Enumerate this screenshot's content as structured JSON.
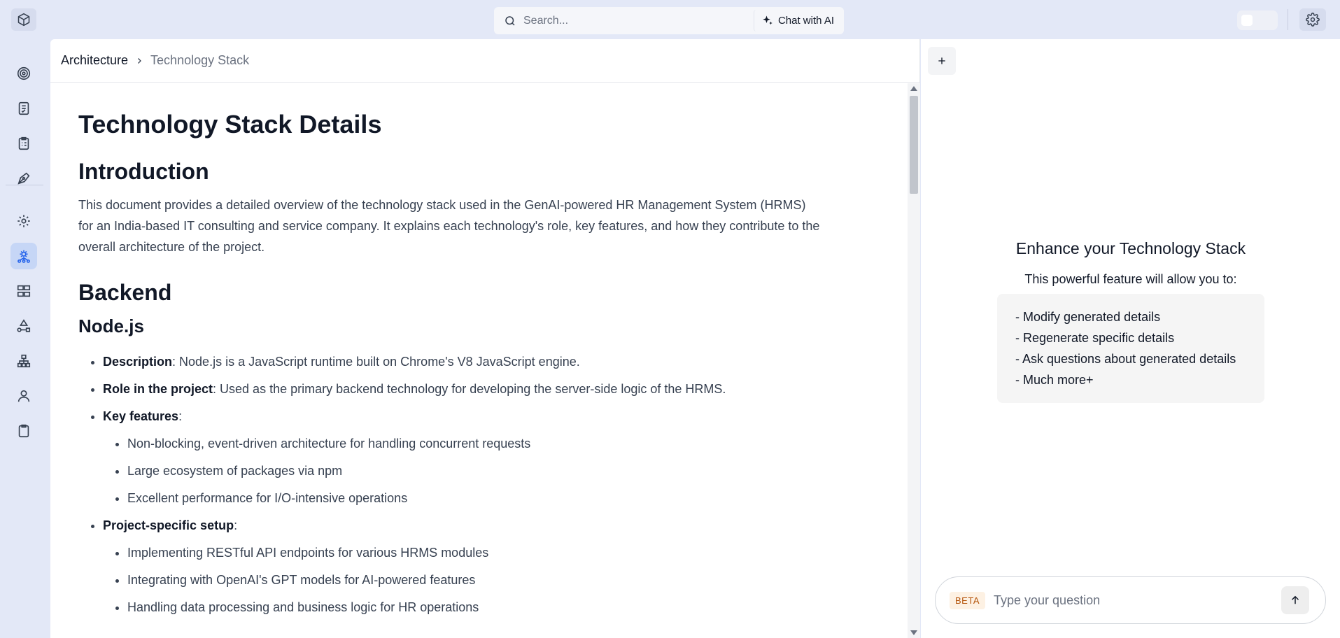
{
  "topbar": {
    "logo_icon": "cube-icon",
    "search_placeholder": "Search...",
    "chat_ai_label": "Chat with AI",
    "chat_ai_icon": "sparkle-icon",
    "settings_icon": "gear-icon"
  },
  "sidebar": {
    "items": [
      {
        "icon": "target-icon"
      },
      {
        "icon": "document-check-icon"
      },
      {
        "icon": "clipboard-list-icon"
      },
      {
        "icon": "pen-tool-icon"
      },
      {
        "icon": "gear-icon"
      },
      {
        "icon": "network-gear-icon",
        "active": true
      },
      {
        "icon": "grid-blocks-icon"
      },
      {
        "icon": "shapes-icon"
      },
      {
        "icon": "sitemap-icon"
      },
      {
        "icon": "user-icon"
      },
      {
        "icon": "clipboard-icon"
      }
    ],
    "active_color": "#c6d6f6"
  },
  "breadcrumb": {
    "parent": "Architecture",
    "current": "Technology Stack"
  },
  "doc": {
    "title": "Technology Stack Details",
    "intro_heading": "Introduction",
    "intro_text": "This document provides a detailed overview of the technology stack used in the GenAI-powered HR Management System (HRMS) for an India-based IT consulting and service company. It explains each technology's role, key features, and how they contribute to the overall architecture of the project.",
    "backend_heading": "Backend",
    "node_heading": "Node.js",
    "node": {
      "description_label": "Description",
      "description_text": ": Node.js is a JavaScript runtime built on Chrome's V8 JavaScript engine.",
      "role_label": "Role in the project",
      "role_text": ": Used as the primary backend technology for developing the server-side logic of the HRMS.",
      "features_label": "Key features",
      "features_suffix": ":",
      "features": [
        "Non-blocking, event-driven architecture for handling concurrent requests",
        "Large ecosystem of packages via npm",
        "Excellent performance for I/O-intensive operations"
      ],
      "setup_label": "Project-specific setup",
      "setup_suffix": ":",
      "setup": [
        "Implementing RESTful API endpoints for various HRMS modules",
        "Integrating with OpenAI's GPT models for AI-powered features",
        "Handling data processing and business logic for HR operations"
      ]
    }
  },
  "ai_panel": {
    "new_chat_icon": "plus-icon",
    "promo_title": "Enhance your Technology Stack",
    "promo_sub": "This powerful feature will allow you to:",
    "promo_items": [
      "- Modify generated details",
      "- Regenerate specific details",
      "- Ask questions about generated details",
      "- Much more+"
    ],
    "beta_label": "BETA",
    "question_placeholder": "Type your question",
    "send_icon": "arrow-up-icon"
  }
}
